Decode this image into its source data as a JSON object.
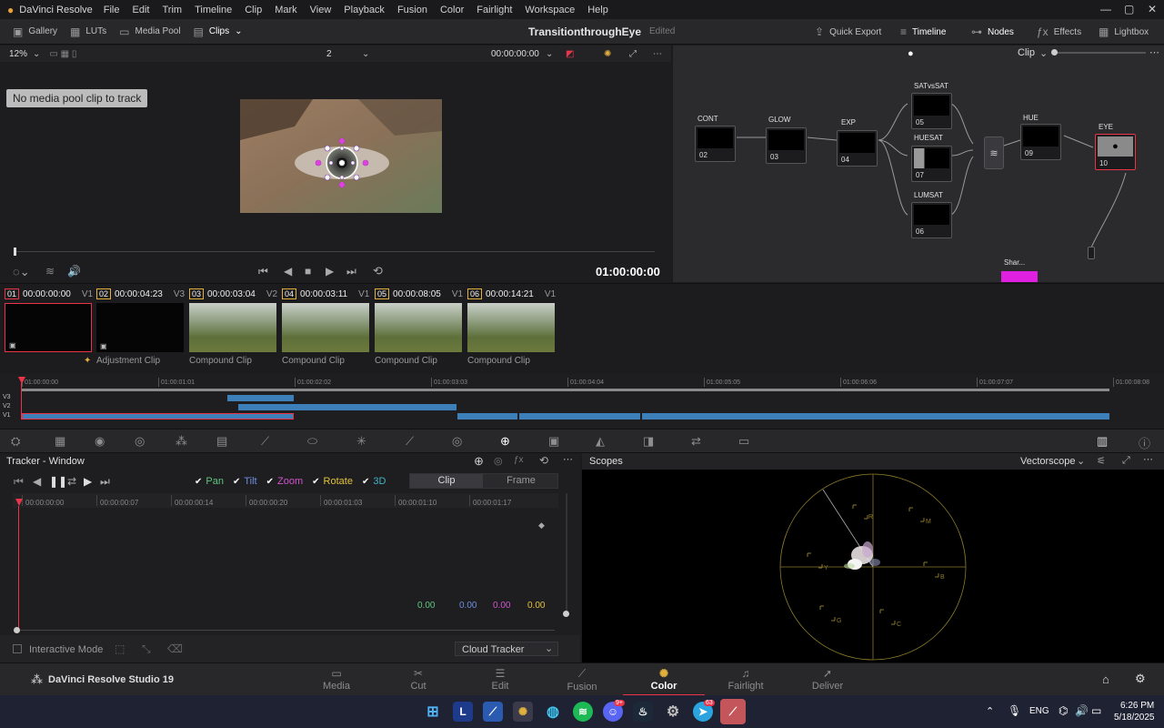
{
  "app": {
    "name": "DaVinci Resolve"
  },
  "menu": [
    "File",
    "Edit",
    "Trim",
    "Timeline",
    "Clip",
    "Mark",
    "View",
    "Playback",
    "Fusion",
    "Color",
    "Fairlight",
    "Workspace",
    "Help"
  ],
  "topbar": {
    "gallery": "Gallery",
    "luts": "LUTs",
    "media_pool": "Media Pool",
    "clips": "Clips",
    "project_title": "TransitionthroughEye",
    "status": "Edited",
    "quick_export": "Quick Export",
    "timeline": "Timeline",
    "nodes": "Nodes",
    "effects": "Effects",
    "lightbox": "Lightbox"
  },
  "viewer": {
    "zoom": "12%",
    "gang": "2",
    "timecode": "00:00:00:00",
    "current_tc": "01:00:00:00",
    "no_clip_msg": "No media pool clip to track",
    "clip_mode": "Clip"
  },
  "nodes": [
    {
      "label": "CONT",
      "num": "02"
    },
    {
      "label": "GLOW",
      "num": "03"
    },
    {
      "label": "EXP",
      "num": "04"
    },
    {
      "label": "SATvsSAT",
      "num": "05"
    },
    {
      "label": "HUESAT",
      "num": "07"
    },
    {
      "label": "LUMSAT",
      "num": "06"
    },
    {
      "label": "HUE",
      "num": "09"
    },
    {
      "label": "EYE",
      "num": "10"
    },
    {
      "label": "Shar...",
      "num": ""
    }
  ],
  "clips": [
    {
      "num": "01",
      "tc": "00:00:00:00",
      "track": "V1",
      "label": ""
    },
    {
      "num": "02",
      "tc": "00:00:04:23",
      "track": "V3",
      "label": "Adjustment Clip"
    },
    {
      "num": "03",
      "tc": "00:00:03:04",
      "track": "V2",
      "label": "Compound Clip"
    },
    {
      "num": "04",
      "tc": "00:00:03:11",
      "track": "V1",
      "label": "Compound Clip"
    },
    {
      "num": "05",
      "tc": "00:00:08:05",
      "track": "V1",
      "label": "Compound Clip"
    },
    {
      "num": "06",
      "tc": "00:00:14:21",
      "track": "V1",
      "label": "Compound Clip"
    }
  ],
  "mini_timeline": {
    "ticks": [
      "01:00:00:00",
      "01:00:01:01",
      "01:00:02:02",
      "01:00:03:03",
      "01:00:04:04",
      "01:00:05:05",
      "01:00:06:06",
      "01:00:07:07",
      "01:00:08:08"
    ],
    "tracks": [
      "V3",
      "V2",
      "V1"
    ]
  },
  "tracker": {
    "title": "Tracker - Window",
    "pan": "Pan",
    "tilt": "Tilt",
    "zoom": "Zoom",
    "rotate": "Rotate",
    "three_d": "3D",
    "clip_tab": "Clip",
    "frame_tab": "Frame",
    "ruler": [
      "00:00:00:00",
      "00:00:00:07",
      "00:00:00:14",
      "00:00:00:20",
      "00:00:01:03",
      "00:00:01:10",
      "00:00:01:17"
    ],
    "values": [
      "0.00",
      "0.00",
      "0.00",
      "0.00"
    ],
    "interactive_mode": "Interactive Mode",
    "cloud_tracker": "Cloud Tracker"
  },
  "scopes": {
    "title": "Scopes",
    "mode": "Vectorscope",
    "targets": [
      "R",
      "M",
      "B",
      "C",
      "G",
      "Y"
    ]
  },
  "pages": [
    "Media",
    "Cut",
    "Edit",
    "Fusion",
    "Color",
    "Fairlight",
    "Deliver"
  ],
  "brand": "DaVinci Resolve Studio 19",
  "taskbar": {
    "lang": "ENG",
    "time": "6:26 PM",
    "date": "5/18/2025",
    "badge1": "9+",
    "badge2": "63"
  },
  "colors": {
    "accent": "#e9344a",
    "yellow": "#e2b03c",
    "blue": "#3d7fb8"
  }
}
